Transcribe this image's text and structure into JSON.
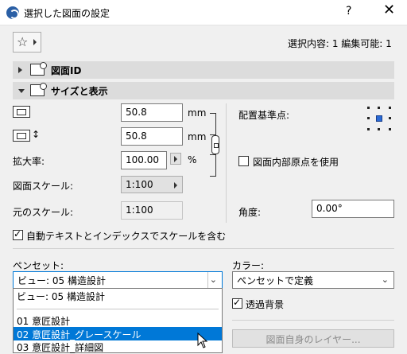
{
  "window": {
    "title": "選択した図面の設定",
    "help_label": "?",
    "close_label": "✕"
  },
  "toolbar": {
    "favorites_icon": "star-icon",
    "selection_info": "選択内容: 1 編集可能: 1"
  },
  "sections": {
    "drawing_id": {
      "label": "図面ID",
      "expanded": false
    },
    "size_display": {
      "label": "サイズと表示",
      "expanded": true
    }
  },
  "size": {
    "width_value": "50.8",
    "width_unit": "mm",
    "height_value": "50.8",
    "height_unit": "mm",
    "magnification_label": "拡大率:",
    "magnification_value": "100.00",
    "magnification_unit": "%",
    "drawing_scale_label": "図面スケール:",
    "drawing_scale_value": "1:100",
    "original_scale_label": "元のスケール:",
    "original_scale_value": "1:100",
    "auto_scale_checkbox_label": "自動テキストとインデックスでスケールを含む",
    "auto_scale_checked": true
  },
  "placement": {
    "anchor_label": "配置基準点:",
    "use_internal_origin_label": "図面内部原点を使用",
    "use_internal_origin_checked": false,
    "angle_label": "角度:",
    "angle_value": "0.00°"
  },
  "pen": {
    "pen_set_label": "ペンセット:",
    "pen_set_selected": "ビュー: 05 構造設計",
    "color_label": "カラー:",
    "color_selected": "ペンセットで定義",
    "transparent_bg_label": "透過背景",
    "transparent_bg_checked": true,
    "layer_button_label": "図面自身のレイヤー..."
  },
  "pen_dropdown": {
    "items": [
      {
        "label": "ビュー: 05 構造設計",
        "highlighted": false
      },
      {
        "label": "01 意匠設計",
        "highlighted": false
      },
      {
        "label": "02 意匠設計_グレースケール",
        "highlighted": true
      },
      {
        "label": "03 意匠設計_詳細図",
        "highlighted": false
      }
    ]
  },
  "colors": {
    "accent": "#0078d7",
    "section_header": "#dcdcdc",
    "dialog_bg": "#f0f0f0"
  }
}
